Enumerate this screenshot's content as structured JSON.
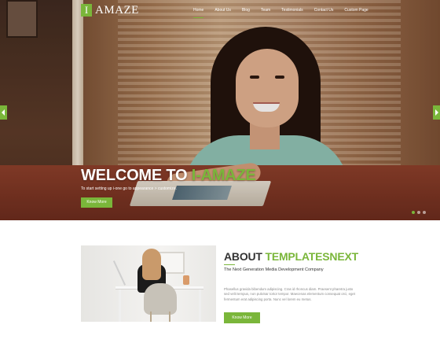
{
  "logo": {
    "mark": "I",
    "text": "AMAZE"
  },
  "nav": {
    "items": [
      {
        "label": "Home",
        "active": true
      },
      {
        "label": "About Us",
        "active": false
      },
      {
        "label": "Blog",
        "active": false
      },
      {
        "label": "Team",
        "active": false
      },
      {
        "label": "Testimonials",
        "active": false
      },
      {
        "label": "Contact Us",
        "active": false
      },
      {
        "label": "Custom Page",
        "active": false
      }
    ]
  },
  "hero": {
    "title_main": "WELCOME TO ",
    "title_accent": "I-AMAZE",
    "subtitle": "To start setting up i-one go to appearance > customize.",
    "button_label": "Know More",
    "prev_icon": "chevron-left-icon",
    "next_icon": "chevron-right-icon",
    "slides": 3,
    "active_slide": 1
  },
  "about": {
    "title_main": "ABOUT ",
    "title_accent": "TEMPLATESNEXT",
    "subtitle": "The Next Generation Media Development Company",
    "body": "Phasellus gravida bibendum adipiscing. Cras id rhoncus diam. Praesent pharetra justo sed velit tempus, non pulvinar tortor tempor. Maecenas elementum consequat orci, eget fermentum erat adipiscing porta. Nunc vel lorem eu metus.",
    "button_label": "Know More"
  },
  "colors": {
    "accent": "#7ab63a",
    "heading": "#333333",
    "body_text": "#8a8a8a"
  }
}
